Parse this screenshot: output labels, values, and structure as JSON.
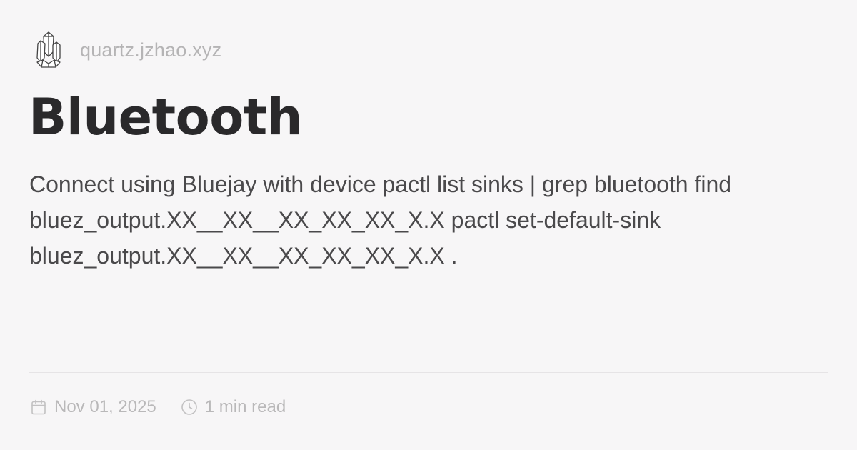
{
  "site": {
    "logo_icon": "crystal-logo-icon",
    "domain": "quartz.jzhao.xyz"
  },
  "article": {
    "title": "Bluetooth",
    "description": "Connect using Bluejay with device pactl list sinks | grep bluetooth find bluez_output.XX__XX__XX_XX_XX_X.X pactl set-default-sink bluez_output.XX__XX__XX_XX_XX_X.X ."
  },
  "meta": {
    "date_icon": "calendar-icon",
    "date": "Nov 01, 2025",
    "read_time_icon": "clock-icon",
    "read_time": "1 min read"
  },
  "colors": {
    "background": "#f7f6f7",
    "title": "#2a292b",
    "body_text": "#4a494b",
    "muted_text": "#b5b4b5",
    "divider": "#e6e4e6"
  }
}
